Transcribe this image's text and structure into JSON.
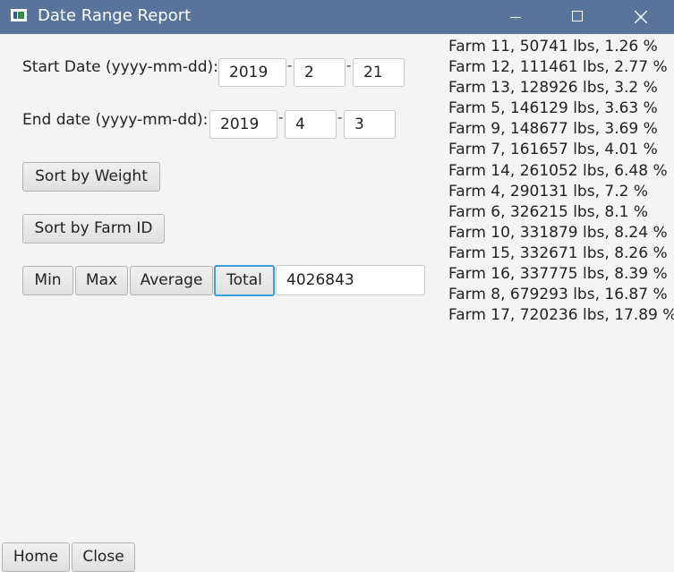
{
  "window": {
    "title": "Date Range Report",
    "icon": "app-window-icon",
    "controls": [
      "minimize-icon",
      "maximize-icon",
      "close-icon"
    ]
  },
  "start_date": {
    "label": "Start Date (yyyy-mm-dd):",
    "year": "2019",
    "month": "2",
    "day": "21",
    "separator": "-"
  },
  "end_date": {
    "label": "End date (yyyy-mm-dd):",
    "year": "2019",
    "month": "4",
    "day": "3",
    "separator": "-"
  },
  "buttons": {
    "sort_weight": "Sort by Weight",
    "sort_farm_id": "Sort by Farm ID",
    "min": "Min",
    "max": "Max",
    "average": "Average",
    "total": "Total",
    "home": "Home",
    "close": "Close"
  },
  "result_value": "4026843",
  "farms": [
    "Farm 11, 50741 lbs, 1.26 %",
    "Farm 12, 111461 lbs, 2.77 %",
    "Farm 13, 128926 lbs, 3.2 %",
    "Farm 5, 146129 lbs, 3.63 %",
    "Farm 9, 148677 lbs, 3.69 %",
    "Farm 7, 161657 lbs, 4.01 %",
    "Farm 14, 261052 lbs, 6.48 %",
    "Farm 4, 290131 lbs, 7.2 %",
    "Farm 6, 326215 lbs, 8.1 %",
    "Farm 10, 331879 lbs, 8.24 %",
    "Farm 15, 332671 lbs, 8.26 %",
    "Farm 16, 337775 lbs, 8.39 %",
    "Farm 8, 679293 lbs, 16.87 %",
    "Farm 17, 720236 lbs, 17.89 %"
  ],
  "colors": {
    "titlebar": "#58749a",
    "background": "#f4f4f4",
    "focus_ring": "#39a1d8"
  }
}
